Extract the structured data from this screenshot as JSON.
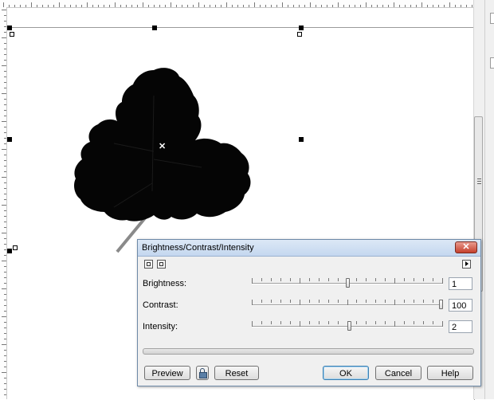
{
  "dialog": {
    "title": "Brightness/Contrast/Intensity",
    "close_label": "✕",
    "rows": [
      {
        "label": "Brightness:",
        "value": "1",
        "fraction": 0.5
      },
      {
        "label": "Contrast:",
        "value": "100",
        "fraction": 1.0
      },
      {
        "label": "Intensity:",
        "value": "2",
        "fraction": 0.51
      }
    ],
    "buttons": {
      "preview": "Preview",
      "reset": "Reset",
      "ok": "OK",
      "cancel": "Cancel",
      "help": "Help"
    }
  },
  "icons": {
    "leaf": "leaf-image",
    "center": "center-marker-icon",
    "lock": "lock-icon",
    "expand": "expand-arrow-icon"
  },
  "colors": {
    "titlebar": "#c4d7ef",
    "close": "#c5402c",
    "leaf": "#050505"
  }
}
